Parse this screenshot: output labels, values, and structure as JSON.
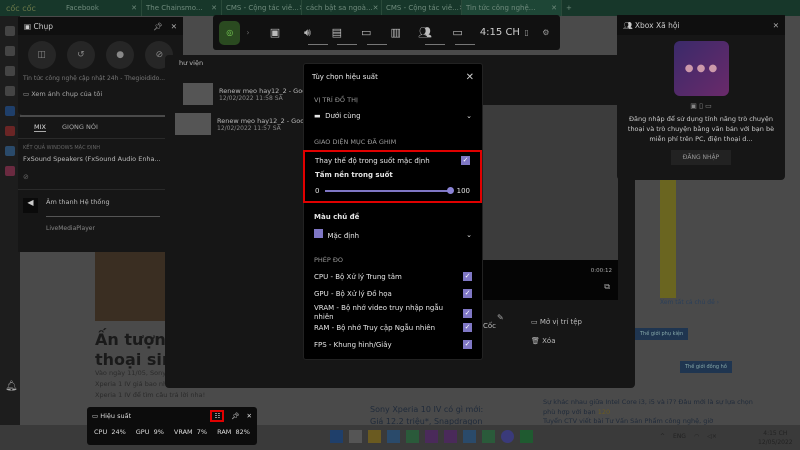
{
  "browser": {
    "brand": "cốc cốc",
    "tabs": [
      {
        "label": "Facebook"
      },
      {
        "label": "The Chainsmo..."
      },
      {
        "label": "CMS - Cộng tác viê..."
      },
      {
        "label": "cách bật sa ngoà..."
      },
      {
        "label": "CMS - Cộng tác viê..."
      },
      {
        "label": "Tin tức công nghệ..."
      }
    ],
    "new_tab": "+"
  },
  "article": {
    "title_line1": "Ấn tượng đ",
    "title_line2": "thoại sinh ra",
    "body": "Vào ngày 11/05, Sony ... của hãng với nhiều nâ... Xperia 1 IV cấu hình ra sao? Sony Xperia 1 IV giá bao nhiêu? Hãy cùng mình điểm qua những ấn tượng đầu tiên Sony Xperia 1 IV để tìm câu trả lời nha!",
    "side_news": "Sony Xperia 10 IV có gì mới: Giá 12.2 triệu*, Snapdragon 695, thiết kế nhiều màu sắc",
    "see_all": "Xem tất cả chủ đề ›",
    "tag1": "Thế giới phụ kiện",
    "tag2": "Thế giới đồng hồ",
    "news1": "Sự khác nhau giữa Intel Core i3, i5 và i7? Đâu mới là sự lựa chọn phù hợp với bạn",
    "news1_count": "120",
    "news2": "Tuyển CTV viết bài Tư Vấn Sản Phẩm công nghệ, giờ"
  },
  "capture": {
    "title": "Chụp",
    "source": "Tin tức công nghệ cập nhật 24h - Thegioididо...",
    "view_captures": "Xem ảnh chụp của tôi"
  },
  "audio": {
    "tabs": [
      "MIX",
      "GIỌNG NÓI"
    ],
    "section": "KẾT QUẢ WINDOWS MẶC ĐỊNH",
    "device": "FxSound Speakers (FxSound Audio Enha...",
    "system_sound": "Âm thanh Hệ thống",
    "app2": "LiveMediaPlayer"
  },
  "gamebar": {
    "time": "4:15 CH"
  },
  "gallery": {
    "label": "hư viện",
    "items": [
      {
        "name": "Renew mẹo hay12_2 - Googl...",
        "date": "12/02/2022 11:58 SA"
      },
      {
        "name": "Renew mẹo hay12_2 - Googl...",
        "date": "12/02/2022 11:57 SA"
      }
    ],
    "duration": "0:00:12",
    "action_copy": "Cốc",
    "open_location": "Mở vị trí tệp",
    "delete": "Xóa"
  },
  "options": {
    "title": "Tùy chọn hiệu suất",
    "graph_pos_label": "VỊ TRÍ ĐỒ THỊ",
    "graph_pos_value": "Dưới cùng",
    "pinned_label": "GIAO DIỆN MỤC ĐÃ GHIM",
    "override_label": "Thay thế độ trong suốt mặc định",
    "override_checked": true,
    "transparency_label": "Tấm nền trong suốt",
    "slider_min": "0",
    "slider_max": "100",
    "slider_value": 100,
    "theme_label": "Màu chủ đề",
    "theme_value": "Mặc định",
    "metrics_label": "PHÉP ĐO",
    "metrics": [
      {
        "label": "CPU - Bộ Xử lý Trung tâm",
        "checked": true
      },
      {
        "label": "GPU - Bộ Xử lý Đồ họa",
        "checked": true
      },
      {
        "label": "VRAM - Bộ nhớ video truy nhập ngẫu nhiên",
        "checked": true
      },
      {
        "label": "RAM - Bộ nhớ Truy cập Ngẫu nhiên",
        "checked": true
      },
      {
        "label": "FPS - Khung hình/Giây",
        "checked": true
      }
    ],
    "accent": "#7f77c5",
    "highlight": "#e00000"
  },
  "social": {
    "title": "Xbox Xã hội",
    "message": "Đăng nhập để sử dụng tính năng trò chuyện thoại và trò chuyện bằng văn bản với bạn bè miễn phí trên PC, điện thoại d...",
    "login": "ĐĂNG NHẬP"
  },
  "performance": {
    "title": "Hiệu suất",
    "stats": [
      {
        "k": "CPU",
        "v": "24%"
      },
      {
        "k": "GPU",
        "v": "9%"
      },
      {
        "k": "VRAM",
        "v": "7%"
      },
      {
        "k": "RAM",
        "v": "82%"
      }
    ]
  },
  "taskbar": {
    "lang": "ENG",
    "time": "4:15 CH",
    "date": "12/05/2022"
  }
}
